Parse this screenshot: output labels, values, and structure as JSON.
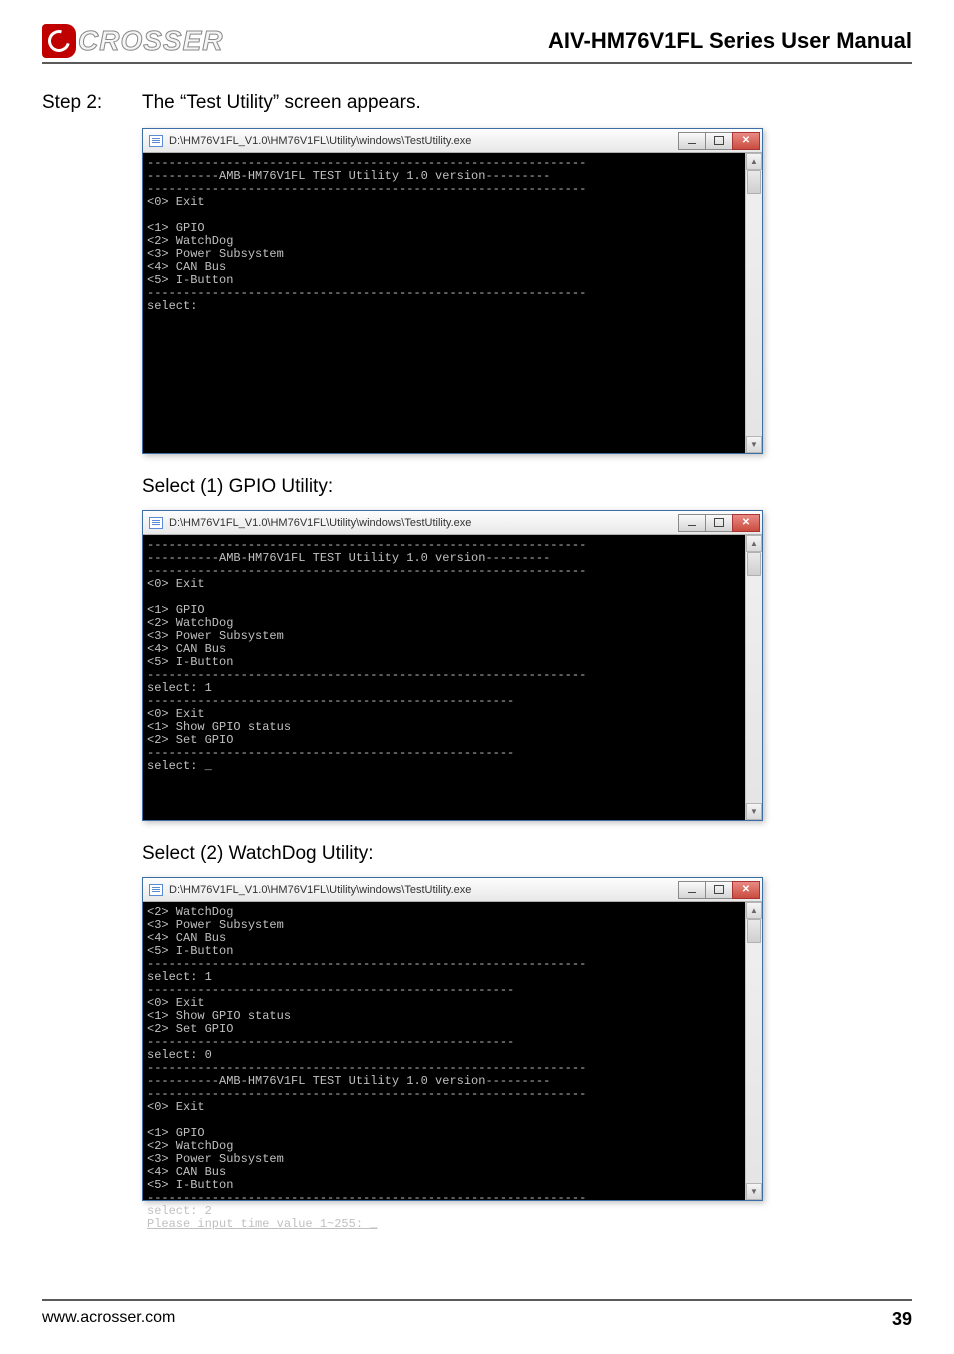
{
  "header": {
    "logo_text": "CROSSER",
    "manual_title": "AIV-HM76V1FL Series User Manual"
  },
  "step": {
    "label": "Step 2:",
    "text": "The “Test Utility” screen appears."
  },
  "caption1": "Select (1) GPIO Utility:",
  "caption2": "Select (2) WatchDog Utility:",
  "window": {
    "title": "D:\\HM76V1FL_V1.0\\HM76V1FL\\Utility\\windows\\TestUtility.exe"
  },
  "console1": "-------------------------------------------------------------\n----------AMB-HM76V1FL TEST Utility 1.0 version---------\n-------------------------------------------------------------\n<0> Exit\n\n<1> GPIO\n<2> WatchDog\n<3> Power Subsystem\n<4> CAN Bus\n<5> I-Button\n-------------------------------------------------------------\nselect:\n\n\n\n\n\n\n\n",
  "console2": "-------------------------------------------------------------\n----------AMB-HM76V1FL TEST Utility 1.0 version---------\n-------------------------------------------------------------\n<0> Exit\n\n<1> GPIO\n<2> WatchDog\n<3> Power Subsystem\n<4> CAN Bus\n<5> I-Button\n-------------------------------------------------------------\nselect: 1\n---------------------------------------------------\n<0> Exit\n<1> Show GPIO status\n<2> Set GPIO\n---------------------------------------------------\nselect: _\n\n\n\n",
  "console3_pre": "<2> WatchDog\n<3> Power Subsystem\n<4> CAN Bus\n<5> I-Button\n-------------------------------------------------------------\nselect: 1\n---------------------------------------------------\n<0> Exit\n<1> Show GPIO status\n<2> Set GPIO\n---------------------------------------------------\nselect: 0\n-------------------------------------------------------------\n----------AMB-HM76V1FL TEST Utility 1.0 version---------\n-------------------------------------------------------------\n<0> Exit\n\n<1> GPIO\n<2> WatchDog\n<3> Power Subsystem\n<4> CAN Bus\n<5> I-Button\n-------------------------------------------------------------\nselect: 2",
  "console3_underline": "Please input time value 1~255: _",
  "footer": {
    "url": "www.acrosser.com",
    "page": "39"
  },
  "scrollbar": {
    "up": "▲",
    "down": "▼"
  }
}
